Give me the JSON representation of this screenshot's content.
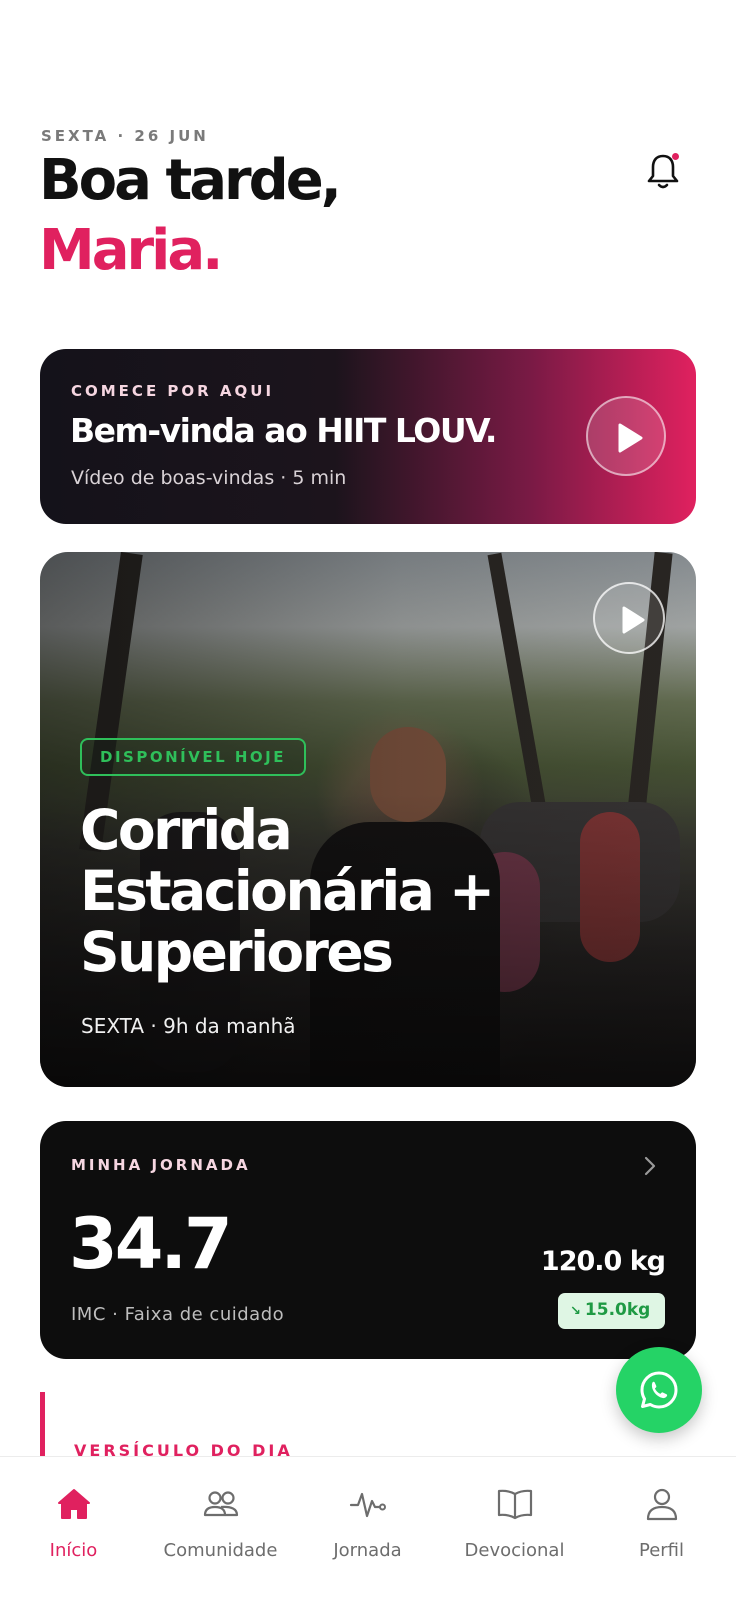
{
  "header": {
    "date": "SEXTA · 26 JUN",
    "greeting": "Boa tarde,",
    "name": "Maria."
  },
  "icons": {
    "notification": "bell-icon",
    "whatsapp": "whatsapp-icon",
    "play": "play-icon"
  },
  "welcome_card": {
    "kicker": "COMECE POR AQUI",
    "title": "Bem-vinda ao HIIT LOUV.",
    "subtitle": "Vídeo de boas-vindas · 5 min"
  },
  "workout_card": {
    "badge": "DISPONÍVEL HOJE",
    "title": "Corrida Estacionária + Superiores",
    "schedule": "SEXTA · 9h da manhã"
  },
  "journey_card": {
    "kicker": "MINHA JORNADA",
    "bmi_value": "34.7",
    "bmi_label": "IMC · Faixa de cuidado",
    "weight": "120.0 kg",
    "weight_change": "15.0kg"
  },
  "verse": {
    "label": "VERSÍCULO DO DIA"
  },
  "nav": {
    "items": [
      {
        "label": "Início",
        "icon": "home-icon",
        "active": true
      },
      {
        "label": "Comunidade",
        "icon": "users-icon",
        "active": false
      },
      {
        "label": "Jornada",
        "icon": "heartbeat-icon",
        "active": false
      },
      {
        "label": "Devocional",
        "icon": "book-icon",
        "active": false
      },
      {
        "label": "Perfil",
        "icon": "user-icon",
        "active": false
      }
    ]
  },
  "colors": {
    "accent": "#e0215f",
    "success": "#2fbf5a",
    "whatsapp": "#25d366",
    "dark_card": "#0d0d0d"
  }
}
